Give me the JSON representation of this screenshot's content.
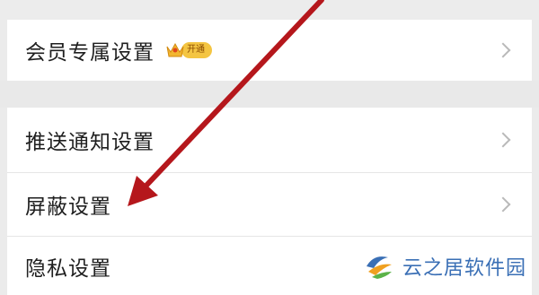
{
  "settings": {
    "member": {
      "label": "会员专属设置",
      "badge": "开通"
    },
    "push": {
      "label": "推送通知设置"
    },
    "block": {
      "label": "屏蔽设置"
    },
    "privacy": {
      "label": "隐私设置"
    }
  },
  "watermark": {
    "text": "云之居软件园"
  },
  "colors": {
    "arrow": "#b5171c",
    "badge": "#f4c542",
    "watermark": "#3a6fb5"
  },
  "icons": [
    "chevron-right-icon",
    "vip-crown-icon",
    "watermark-logo-icon"
  ]
}
